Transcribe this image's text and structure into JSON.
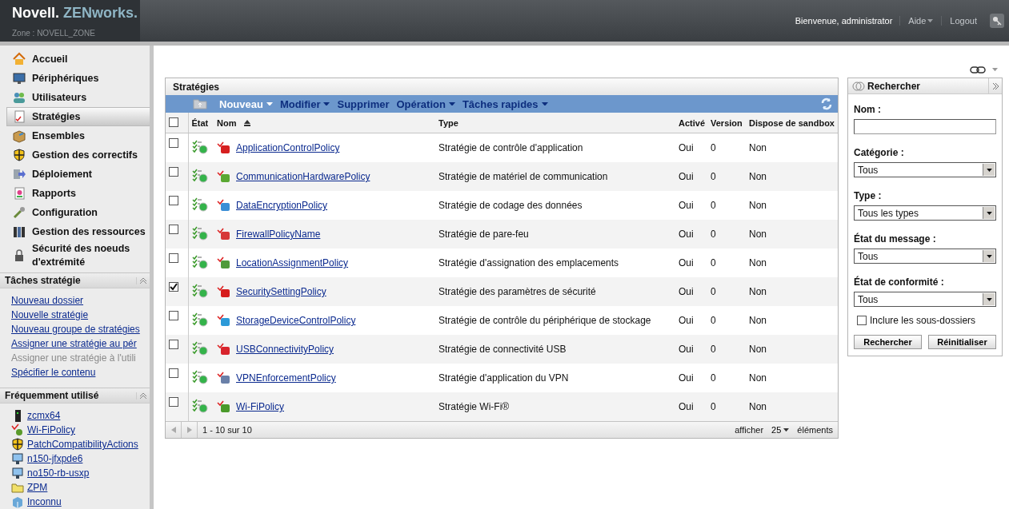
{
  "header": {
    "brand": "Novell.",
    "product": "ZENworks.",
    "zone": "Zone : NOVELL_ZONE",
    "welcome": "Bienvenue, administrator",
    "help": "Aide",
    "logout": "Logout"
  },
  "nav": [
    {
      "label": "Accueil",
      "selected": false
    },
    {
      "label": "Périphériques",
      "selected": false
    },
    {
      "label": "Utilisateurs",
      "selected": false
    },
    {
      "label": "Stratégies",
      "selected": true
    },
    {
      "label": "Ensembles",
      "selected": false
    },
    {
      "label": "Gestion des correctifs",
      "selected": false
    },
    {
      "label": "Déploiement",
      "selected": false
    },
    {
      "label": "Rapports",
      "selected": false
    },
    {
      "label": "Configuration",
      "selected": false
    },
    {
      "label": "Gestion des ressources",
      "selected": false
    },
    {
      "label": "Sécurité des noeuds d'extrémité",
      "selected": false
    }
  ],
  "tasks": {
    "title": "Tâches stratégie",
    "items": [
      {
        "label": "Nouveau dossier",
        "disabled": false
      },
      {
        "label": "Nouvelle stratégie",
        "disabled": false
      },
      {
        "label": "Nouveau groupe de stratégies",
        "disabled": false
      },
      {
        "label": "Assigner une stratégie au pér",
        "disabled": false
      },
      {
        "label": "Assigner une stratégie à l'utili",
        "disabled": true
      },
      {
        "label": "Spécifier le contenu",
        "disabled": false
      }
    ]
  },
  "frequent": {
    "title": "Fréquemment utilisé",
    "items": [
      "zcmx64",
      "Wi-FiPolicy",
      "PatchCompatibilityActions",
      "n150-jfxpde6",
      "no150-rb-usxp",
      "ZPM",
      "Inconnu"
    ]
  },
  "panel": {
    "title": "Stratégies",
    "toolbar": [
      {
        "label": "Nouveau",
        "dropdown": true,
        "highlighted": true
      },
      {
        "label": "Modifier",
        "dropdown": true,
        "highlighted": false
      },
      {
        "label": "Supprimer",
        "dropdown": false,
        "highlighted": false
      },
      {
        "label": "Opération",
        "dropdown": true,
        "highlighted": false
      },
      {
        "label": "Tâches rapides",
        "dropdown": true,
        "highlighted": false
      }
    ],
    "select_all_checked": false,
    "columns": [
      {
        "label": "État",
        "sorted": false
      },
      {
        "label": "Nom",
        "sorted": true
      },
      {
        "label": "Type",
        "sorted": false
      },
      {
        "label": "Activé",
        "sorted": false
      },
      {
        "label": "Version",
        "sorted": false
      },
      {
        "label": "Dispose de sandbox",
        "sorted": false
      }
    ],
    "rows": [
      {
        "checked": false,
        "name": "ApplicationControlPolicy",
        "type": "Stratégie de contrôle d'application",
        "active": "Oui",
        "version": "0",
        "sandbox": "Non"
      },
      {
        "checked": false,
        "name": "CommunicationHardwarePolicy",
        "type": "Stratégie de matériel de communication",
        "active": "Oui",
        "version": "0",
        "sandbox": "Non"
      },
      {
        "checked": false,
        "name": "DataEncryptionPolicy",
        "type": "Stratégie de codage des données",
        "active": "Oui",
        "version": "0",
        "sandbox": "Non"
      },
      {
        "checked": false,
        "name": "FirewallPolicyName",
        "type": "Stratégie de pare-feu",
        "active": "Oui",
        "version": "0",
        "sandbox": "Non"
      },
      {
        "checked": false,
        "name": "LocationAssignmentPolicy",
        "type": "Stratégie d'assignation des emplacements",
        "active": "Oui",
        "version": "0",
        "sandbox": "Non"
      },
      {
        "checked": true,
        "name": "SecuritySettingPolicy",
        "type": "Stratégie des paramètres de sécurité",
        "active": "Oui",
        "version": "0",
        "sandbox": "Non"
      },
      {
        "checked": false,
        "name": "StorageDeviceControlPolicy",
        "type": "Stratégie de contrôle du périphérique de stockage",
        "active": "Oui",
        "version": "0",
        "sandbox": "Non"
      },
      {
        "checked": false,
        "name": "USBConnectivityPolicy",
        "type": "Stratégie de connectivité USB",
        "active": "Oui",
        "version": "0",
        "sandbox": "Non"
      },
      {
        "checked": false,
        "name": "VPNEnforcementPolicy",
        "type": "Stratégie d'application du VPN",
        "active": "Oui",
        "version": "0",
        "sandbox": "Non"
      },
      {
        "checked": false,
        "name": "Wi-FiPolicy",
        "type": "Stratégie Wi-Fi®",
        "active": "Oui",
        "version": "0",
        "sandbox": "Non"
      }
    ],
    "footer": {
      "range": "1 - 10 sur 10",
      "show": "afficher",
      "page_size": "25",
      "items_label": "éléments"
    }
  },
  "search": {
    "title": "Rechercher",
    "fields": [
      {
        "kind": "text",
        "label": "Nom :"
      },
      {
        "kind": "select",
        "label": "Catégorie :",
        "value": "Tous"
      },
      {
        "kind": "select",
        "label": "Type :",
        "value": "Tous les types"
      },
      {
        "kind": "select",
        "label": "État du message :",
        "value": "Tous"
      },
      {
        "kind": "select",
        "label": "État de conformité :",
        "value": "Tous"
      }
    ],
    "include_subfolders": {
      "label": "Inclure les sous-dossiers",
      "checked": false
    },
    "buttons": [
      "Rechercher",
      "Réinitialiser"
    ]
  }
}
